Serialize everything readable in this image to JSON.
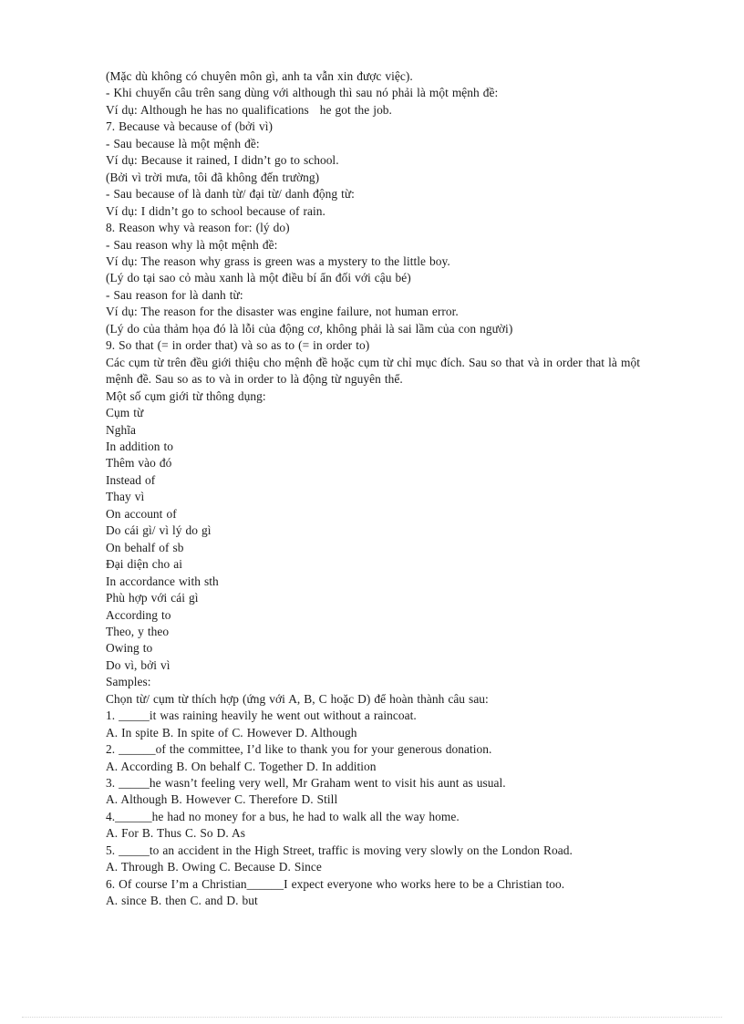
{
  "document": {
    "background_color": "#ffffff",
    "text_color": "#1b1b1b",
    "lines": [
      "(Mặc dù không có chuyên môn gì, anh ta vẫn xin được việc).",
      "- Khi chuyển câu trên sang dùng với although thì sau nó phải là một mệnh đề:",
      "Ví dụ: Although he has no qualifications   he got the job.",
      "7. Because và because of (bởi vì)",
      "- Sau because là một mệnh đề:",
      "Ví dụ: Because it rained, I didn’t go to school.",
      "(Bởi vì trời mưa, tôi đã không đến trường)",
      "- Sau because of là danh từ/ đại từ/ danh động từ:",
      "Ví dụ: I didn’t go to school because of rain.",
      "8. Reason why và reason for: (lý do)",
      "- Sau reason why là một mệnh đề:",
      "Ví dụ: The reason why grass is green was a mystery to the little boy.",
      "(Lý do tại sao cỏ màu xanh là một điều bí ẩn đối với cậu bé)",
      "- Sau reason for là danh từ:",
      "Ví dụ: The reason for the disaster was engine failure, not human error.",
      "(Lý do của thảm họa đó là lỗi của động cơ, không phải là sai lầm của con người)",
      "9. So that (= in order that) và so as to (= in order to)",
      "Các cụm từ trên đều giới thiệu cho mệnh đề hoặc cụm từ chỉ mục đích. Sau so that và in order that là một mệnh đề. Sau so as to và in order to là động từ nguyên thể.",
      "Một số cụm giới từ thông dụng:",
      "Cụm từ",
      "Nghĩa",
      "In addition to",
      "Thêm vào đó",
      "Instead of",
      "Thay vì",
      "On account of",
      "Do cái gì/ vì lý do gì",
      "On behalf of sb",
      "Đại diện cho ai",
      "In accordance with sth",
      "Phù hợp với cái gì",
      "According to",
      "Theo, y theo",
      "Owing to",
      "Do vì, bởi vì",
      "Samples:",
      "Chọn từ/ cụm từ thích hợp (ứng với A, B, C hoặc D) để hoàn thành câu sau:",
      "1. _____it was raining heavily he went out without a raincoat.",
      "A. In spite B. In spite of C. However D. Although",
      "2. ______of the committee, I’d like to thank you for your generous donation.",
      "A. According B. On behalf C. Together D. In addition",
      "3. _____he wasn’t feeling very well, Mr Graham went to visit his aunt as usual.",
      "A. Although B. However C. Therefore D. Still",
      "4.______he had no money for a bus, he had to walk all the way home.",
      "A. For B. Thus C. So D. As",
      "5. _____to an accident in the High Street, traffic is moving very slowly on the London Road.",
      "A. Through B. Owing C. Because D. Since",
      "6. Of course I’m a Christian______I expect everyone who works here to be a Christian too.",
      "A. since B. then C. and D. but"
    ]
  }
}
